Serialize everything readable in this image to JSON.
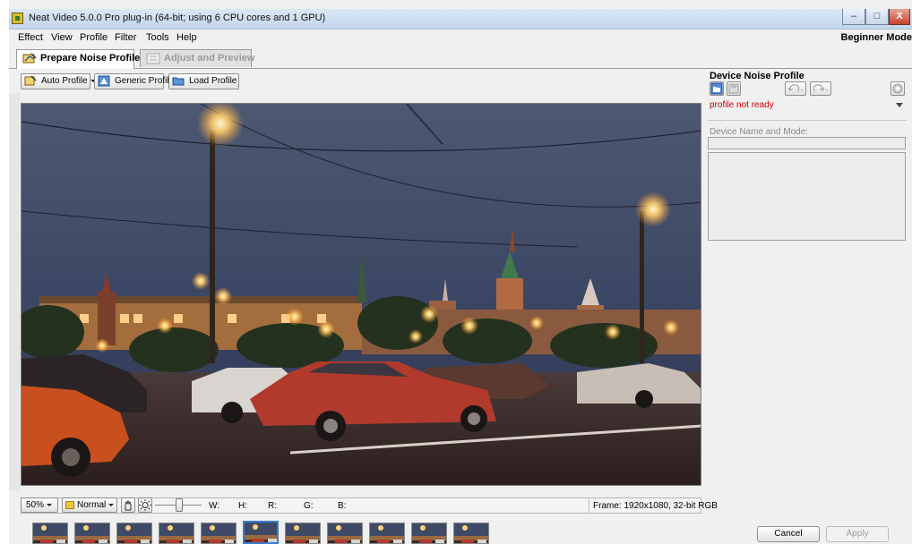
{
  "window": {
    "title": "Neat Video 5.0.0  Pro plug-in (64-bit; using 6 CPU cores and 1 GPU)",
    "controls": {
      "minimize": "–",
      "maximize": "□",
      "close": "X"
    }
  },
  "menu": {
    "items": [
      "Effect",
      "View",
      "Profile",
      "Filter",
      "Tools",
      "Help"
    ],
    "mode_label": "Beginner Mode"
  },
  "tabs": [
    {
      "label": "Prepare Noise Profile",
      "active": true,
      "icon": "prepare-profile-icon"
    },
    {
      "label": "Adjust and Preview",
      "active": false,
      "icon": "adjust-preview-icon"
    }
  ],
  "toolbar": {
    "auto_profile": "Auto Profile",
    "generic_profile": "Generic Profile",
    "load_profile": "Load Profile"
  },
  "statusbar": {
    "zoom": "50%",
    "blend_mode": "Normal",
    "w_label": "W:",
    "h_label": "H:",
    "r_label": "R:",
    "g_label": "G:",
    "b_label": "B:",
    "frame_info": "Frame: 1920x1080, 32-bit RGB"
  },
  "device_panel": {
    "title": "Device Noise Profile",
    "status": "profile not ready",
    "name_label": "Device Name and Mode:",
    "name_value": "",
    "notes_value": ""
  },
  "filmstrip": {
    "count": 11,
    "selected_index": 5
  },
  "actions": {
    "cancel": "Cancel",
    "apply": "Apply"
  },
  "colors": {
    "status_error": "#cc0000",
    "selected_thumb": "#3a7dcc",
    "sky": "#3b4a66",
    "street": "#3a2a26"
  }
}
